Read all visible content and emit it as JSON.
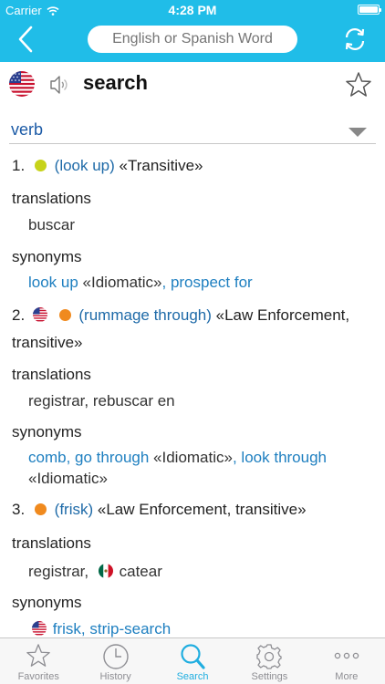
{
  "status": {
    "carrier": "Carrier",
    "time": "4:28 PM",
    "battery_level": 1.0
  },
  "search": {
    "placeholder": "English or Spanish Word"
  },
  "entry": {
    "headword": "search",
    "pos": "verb"
  },
  "senses": [
    {
      "number": "1.",
      "dot_color": "#c7d31a",
      "gloss": "(look up)",
      "label": "«Transitive»",
      "translations_title": "translations",
      "translations": "buscar",
      "synonyms_title": "synonyms",
      "synonyms": [
        {
          "link": "look up",
          "label": " «Idiomatic»"
        },
        {
          "link": ", prospect for",
          "label": ""
        }
      ]
    },
    {
      "number": "2.",
      "dot_color": "#f08a1e",
      "gloss": "(rummage through)",
      "label": "«Law Enforcement,",
      "label_cont": "transitive»",
      "translations_title": "translations",
      "translations": "registrar, rebuscar en",
      "synonyms_title": "synonyms",
      "synonyms_line1": [
        {
          "link": "comb, go through",
          "label": " «Idiomatic»"
        },
        {
          "link": ", look through",
          "label": ""
        }
      ],
      "synonyms_line2": "«Idiomatic»"
    },
    {
      "number": "3.",
      "dot_color": "#f08a1e",
      "gloss": "(frisk)",
      "label": "«Law Enforcement, transitive»",
      "translations_title": "translations",
      "translations_a": "registrar,",
      "translations_b": "catear",
      "synonyms_title": "synonyms",
      "synonyms": "frisk, strip-search"
    }
  ],
  "tabs": [
    {
      "label": "Favorites",
      "icon": "star-icon"
    },
    {
      "label": "History",
      "icon": "clock-icon"
    },
    {
      "label": "Search",
      "icon": "search-icon"
    },
    {
      "label": "Settings",
      "icon": "gear-icon"
    },
    {
      "label": "More",
      "icon": "more-icon"
    }
  ],
  "colors": {
    "accent": "#20bde8",
    "link": "#1e7fc0",
    "pos": "#1b5aa6",
    "tab_active": "#20aee0"
  }
}
